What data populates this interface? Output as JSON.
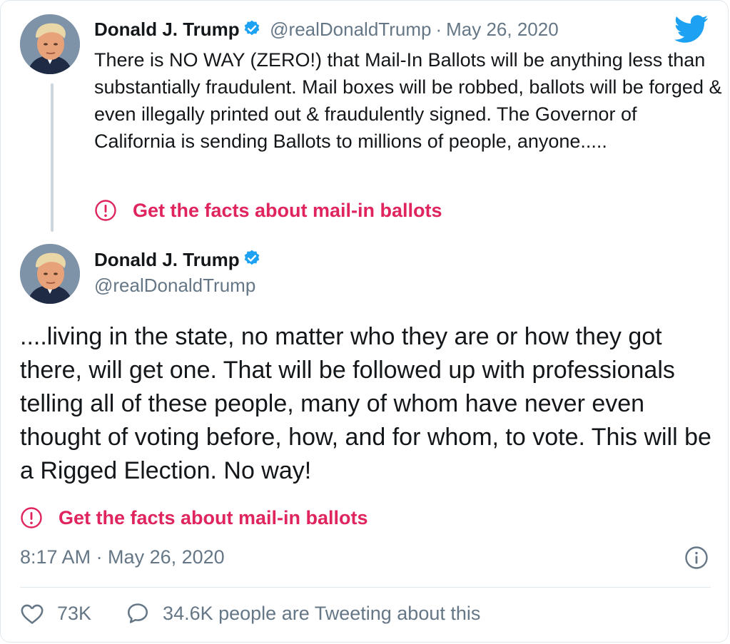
{
  "tweet1": {
    "author_name": "Donald J. Trump",
    "handle": "@realDonaldTrump",
    "separator": "·",
    "date": "May 26, 2020",
    "text": "There is NO WAY (ZERO!) that Mail-In Ballots will be anything less than substantially fraudulent. Mail boxes will be robbed, ballots will be forged & even illegally printed out & fraudulently signed. The Governor of California is sending Ballots to millions of people, anyone.....",
    "facts_label": "Get the facts about mail-in ballots"
  },
  "tweet2": {
    "author_name": "Donald J. Trump",
    "handle": "@realDonaldTrump",
    "text": "....living in the state, no matter who they are or how they got there, will get one. That will be followed up with professionals telling all of these people, many of whom have never even thought of voting before, how, and for whom, to vote. This will be a Rigged Election. No way!",
    "facts_label": "Get the facts about mail-in ballots",
    "timestamp": "8:17 AM · May 26, 2020",
    "likes": "73K",
    "tweeting_about": "34.6K people are Tweeting about this"
  },
  "icons": {
    "brand": "twitter-bird-icon",
    "verified": "verified-badge-icon",
    "warning": "exclamation-circle-icon",
    "info": "info-icon",
    "like": "heart-icon",
    "reply": "speech-bubble-icon"
  },
  "colors": {
    "twitter_blue": "#1da1f2",
    "warning_red": "#e0245e",
    "secondary_text": "#657786",
    "border": "#e1e8ed"
  }
}
